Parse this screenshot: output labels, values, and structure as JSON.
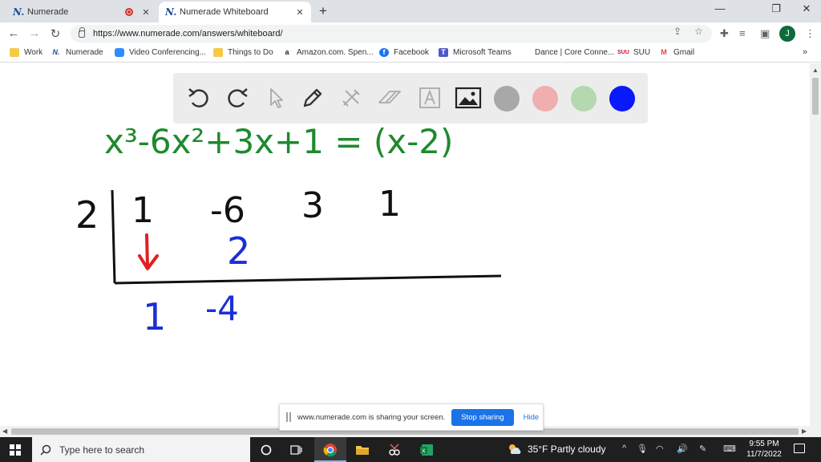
{
  "tabs": [
    {
      "title": "Numerade",
      "favicon": "numerade-n-icon",
      "recording": true
    },
    {
      "title": "Numerade Whiteboard",
      "favicon": "numerade-n-icon",
      "active": true
    }
  ],
  "favicon_letter": "N.",
  "new_tab_symbol": "+",
  "window_controls": {
    "minimize": "—",
    "restore": "❐",
    "close": "✕"
  },
  "address_bar": {
    "url": "https://www.numerade.com/answers/whiteboard/"
  },
  "profile_initial": "J",
  "bookmarks": [
    {
      "label": "Work",
      "icon": "folder-icon"
    },
    {
      "label": "Numerade",
      "icon": "numerade-n-icon"
    },
    {
      "label": "Video Conferencing...",
      "icon": "video-icon"
    },
    {
      "label": "Things to Do",
      "icon": "folder-icon"
    },
    {
      "label": "Amazon.com. Spen...",
      "icon": "amazon-icon"
    },
    {
      "label": "Facebook",
      "icon": "facebook-icon"
    },
    {
      "label": "Microsoft Teams",
      "icon": "teams-icon"
    },
    {
      "label": "Dance | Core Conne...",
      "icon": "page-icon"
    },
    {
      "label": "SUU",
      "icon": "suu-icon"
    },
    {
      "label": "Gmail",
      "icon": "gmail-icon"
    }
  ],
  "bookmarks_more": "»",
  "whiteboard": {
    "equation": "x³-6x²+3x+1 = (x-2)",
    "divisor": "2",
    "coefficients": [
      "1",
      "-6",
      "3",
      "1"
    ],
    "carry_row": [
      "2"
    ],
    "result_row": [
      "1",
      "-4"
    ],
    "colors": {
      "equation": "#1e8a2e",
      "ink": "#111111",
      "arrow": "#e02020",
      "work": "#1a2fd6"
    }
  },
  "toolbar": {
    "tools": [
      "undo-icon",
      "redo-icon",
      "pointer-icon",
      "pen-icon",
      "tools-icon",
      "eraser-icon",
      "text-icon",
      "image-icon"
    ],
    "swatches": [
      "#a8a8a8",
      "#f0aeae",
      "#b4d8b0",
      "#0a18ff"
    ]
  },
  "share_bar": {
    "message": "www.numerade.com is sharing your screen.",
    "stop_label": "Stop sharing",
    "hide_label": "Hide"
  },
  "taskbar": {
    "search_placeholder": "Type here to search",
    "weather": "35°F  Partly cloudy",
    "time": "9:55 PM",
    "date": "11/7/2022"
  }
}
